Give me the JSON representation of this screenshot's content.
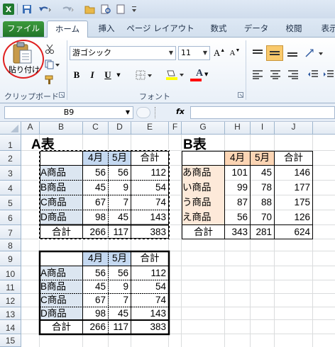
{
  "qat": {
    "logo": "X",
    "icons": [
      "save-icon",
      "undo-icon",
      "redo-icon",
      "open-folder-icon",
      "print-preview-icon",
      "new-document-icon",
      "customize-icon"
    ]
  },
  "tabs": [
    {
      "label": "ファイル"
    },
    {
      "label": "ホーム"
    },
    {
      "label": "挿入"
    },
    {
      "label": "ページ レイアウト"
    },
    {
      "label": "数式"
    },
    {
      "label": "データ"
    },
    {
      "label": "校閲"
    },
    {
      "label": "表示"
    }
  ],
  "ribbon": {
    "paste_label": "貼り付け",
    "clipboard_group": "クリップボード",
    "font_group": "フォント",
    "font_name": "游ゴシック",
    "font_size": "11",
    "bold": "B",
    "italic": "I",
    "underline": "U",
    "grow": "A",
    "shrink": "A",
    "font_color_letter": "A",
    "accent_colors": {
      "highlight": "#ffff00",
      "font_color": "#ff0000",
      "active_align": "#f9c96c"
    }
  },
  "formula_bar": {
    "name_box": "B9",
    "fx": "fx",
    "value": ""
  },
  "columns": [
    "A",
    "B",
    "C",
    "D",
    "E",
    "F",
    "G",
    "H",
    "I",
    "J"
  ],
  "rows": [
    "1",
    "2",
    "3",
    "4",
    "5",
    "6",
    "7",
    "8",
    "9",
    "10",
    "11",
    "12",
    "13",
    "14",
    "15"
  ],
  "table_a": {
    "title": "A表",
    "header": [
      "",
      "4月",
      "5月",
      "合計"
    ],
    "rows": [
      [
        "A商品",
        "56",
        "56",
        "112"
      ],
      [
        "B商品",
        "45",
        "9",
        "54"
      ],
      [
        "C商品",
        "67",
        "7",
        "74"
      ],
      [
        "D商品",
        "98",
        "45",
        "143"
      ]
    ],
    "total": [
      "合計",
      "266",
      "117",
      "383"
    ]
  },
  "table_b": {
    "title": "B表",
    "header": [
      "",
      "4月",
      "5月",
      "合計"
    ],
    "rows": [
      [
        "あ商品",
        "101",
        "45",
        "146"
      ],
      [
        "い商品",
        "99",
        "78",
        "177"
      ],
      [
        "う商品",
        "87",
        "88",
        "175"
      ],
      [
        "え商品",
        "56",
        "70",
        "126"
      ]
    ],
    "total": [
      "合計",
      "343",
      "281",
      "624"
    ]
  },
  "table_c": {
    "header": [
      "",
      "4月",
      "5月",
      "合計"
    ],
    "rows": [
      [
        "A商品",
        "56",
        "56",
        "112"
      ],
      [
        "B商品",
        "45",
        "9",
        "54"
      ],
      [
        "C商品",
        "67",
        "7",
        "74"
      ],
      [
        "D商品",
        "98",
        "45",
        "143"
      ]
    ],
    "total": [
      "合計",
      "266",
      "117",
      "383"
    ]
  }
}
